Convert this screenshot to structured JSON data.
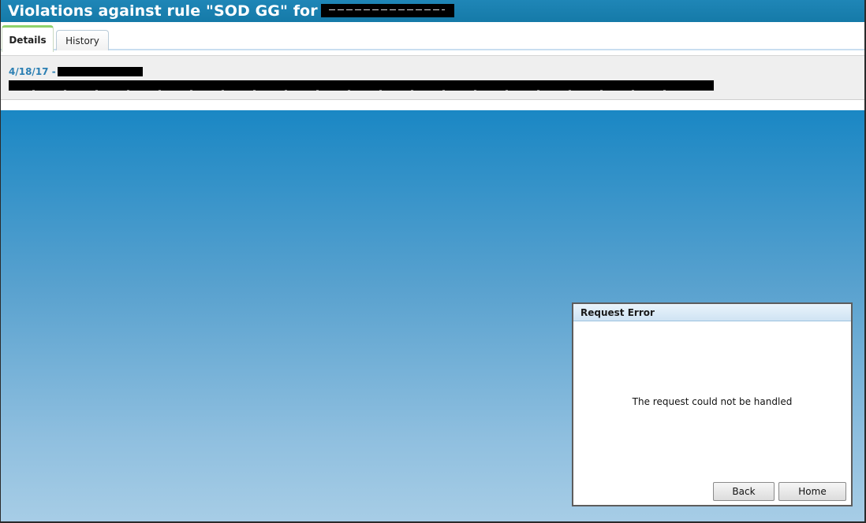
{
  "window": {
    "title": "Violations against rule \"SOD GG\" for"
  },
  "tabs": [
    {
      "label": "Details",
      "active": true
    },
    {
      "label": "History",
      "active": false
    }
  ],
  "details": {
    "date": "4/18/17 -"
  },
  "dialog": {
    "title": "Request Error",
    "message": "The request could not be handled",
    "back_label": "Back",
    "home_label": "Home"
  },
  "colors": {
    "titlebar": "#1a82b3",
    "link": "#2b7fb3",
    "tab_active_accent": "#8fd16a",
    "backdrop_top": "#1a87c4",
    "backdrop_bottom": "#a7cde6"
  }
}
